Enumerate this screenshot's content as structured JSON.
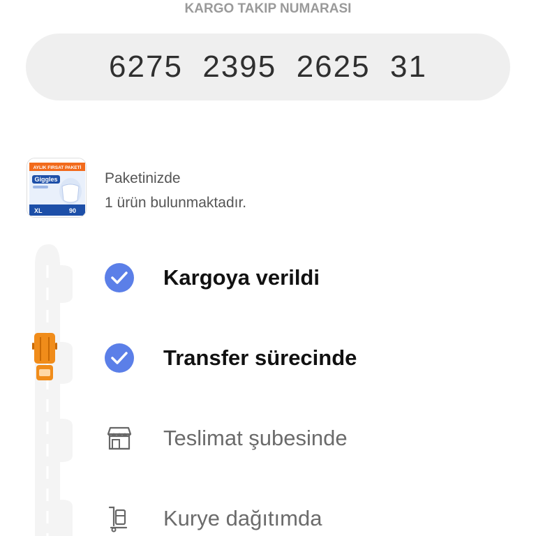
{
  "header": {
    "title": "KARGO TAKIP NUMARASI",
    "tracking_number": "6275  2395  2625  31"
  },
  "package": {
    "line1": "Paketinizde",
    "line2": "1 ürün bulunmaktadır.",
    "thumb_banner": "AYLIK FIRSAT PAKETİ",
    "thumb_brand": "Giggles",
    "thumb_size": "XL",
    "thumb_count": "90"
  },
  "steps": [
    {
      "label": "Kargoya verildi",
      "status": "done",
      "icon": "check-circle-icon"
    },
    {
      "label": "Transfer sürecinde",
      "status": "done",
      "icon": "check-circle-icon"
    },
    {
      "label": "Teslimat şubesinde",
      "status": "pending",
      "icon": "storefront-icon"
    },
    {
      "label": "Kurye dağıtımda",
      "status": "pending",
      "icon": "courier-trolley-icon"
    }
  ],
  "colors": {
    "accent": "#5b7fe8",
    "truck": "#f08c1a",
    "pill_bg": "#efefef"
  }
}
